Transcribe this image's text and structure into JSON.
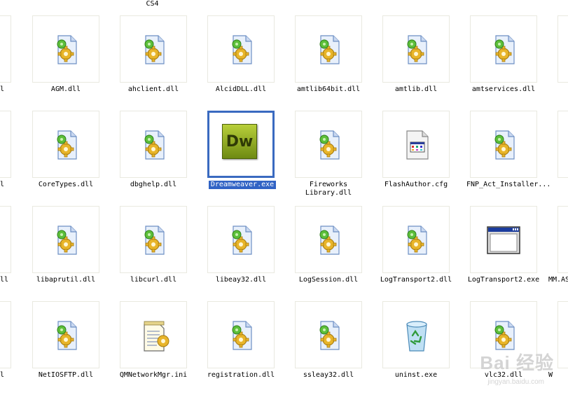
{
  "top_partial_label": "CS4",
  "left_edge_labels": [
    "l",
    "l",
    "ll",
    "l"
  ],
  "right_edge_labels": [
    "",
    "",
    "MM.AS",
    "W"
  ],
  "files": [
    {
      "name": "AGM.dll",
      "icon": "dll-file-icon"
    },
    {
      "name": "ahclient.dll",
      "icon": "dll-file-icon"
    },
    {
      "name": "AlcidDLL.dll",
      "icon": "dll-file-icon"
    },
    {
      "name": "amtlib64bit.dll",
      "icon": "dll-file-icon"
    },
    {
      "name": "amtlib.dll",
      "icon": "dll-file-icon"
    },
    {
      "name": "amtservices.dll",
      "icon": "dll-file-icon"
    },
    {
      "name": "CoreTypes.dll",
      "icon": "dll-file-icon"
    },
    {
      "name": "dbghelp.dll",
      "icon": "dll-file-icon"
    },
    {
      "name": "Dreamweaver.exe",
      "icon": "dreamweaver-app-icon",
      "selected": true,
      "icon_text": "Dw"
    },
    {
      "name": "Fireworks Library.dll",
      "icon": "dll-file-icon"
    },
    {
      "name": "FlashAuthor.cfg",
      "icon": "cfg-file-icon"
    },
    {
      "name": "FNP_Act_Installer...",
      "icon": "dll-file-icon"
    },
    {
      "name": "libaprutil.dll",
      "icon": "dll-file-icon"
    },
    {
      "name": "libcurl.dll",
      "icon": "dll-file-icon"
    },
    {
      "name": "libeay32.dll",
      "icon": "dll-file-icon"
    },
    {
      "name": "LogSession.dll",
      "icon": "dll-file-icon"
    },
    {
      "name": "LogTransport2.dll",
      "icon": "dll-file-icon"
    },
    {
      "name": "LogTransport2.exe",
      "icon": "exe-window-icon"
    },
    {
      "name": "NetIOSFTP.dll",
      "icon": "dll-file-icon"
    },
    {
      "name": "QMNetworkMgr.ini",
      "icon": "ini-file-icon"
    },
    {
      "name": "registration.dll",
      "icon": "dll-file-icon"
    },
    {
      "name": "ssleay32.dll",
      "icon": "dll-file-icon"
    },
    {
      "name": "uninst.exe",
      "icon": "recycle-bin-icon"
    },
    {
      "name": "vlc32.dll",
      "icon": "dll-file-icon"
    }
  ],
  "watermark": {
    "text": "Bai 经验",
    "sub": "jingyan.baidu.com"
  }
}
